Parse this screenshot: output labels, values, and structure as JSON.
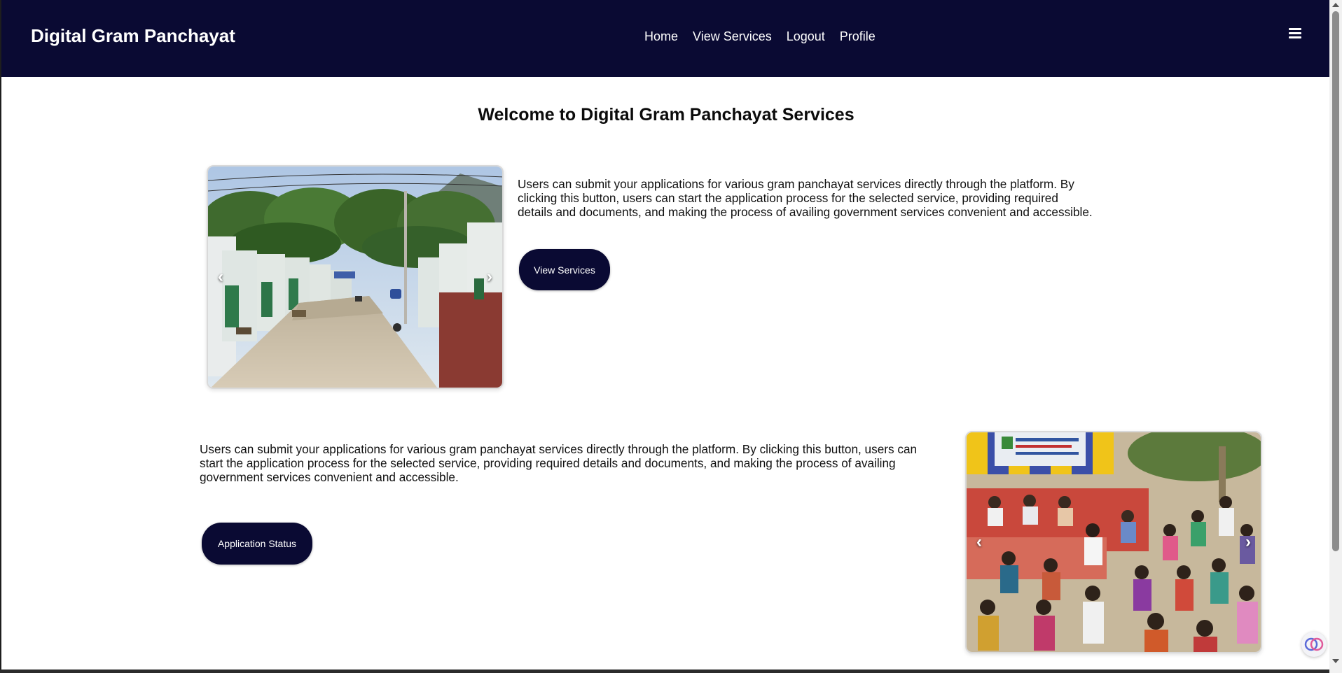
{
  "navbar": {
    "brand": "Digital Gram Panchayat",
    "links": [
      {
        "label": "Home"
      },
      {
        "label": "View Services"
      },
      {
        "label": "Logout"
      },
      {
        "label": "Profile"
      }
    ],
    "menu_icon": "hamburger-icon",
    "background": "#0a0a33"
  },
  "main": {
    "title": "Welcome to Digital Gram Panchayat Services",
    "section1": {
      "image": "village-street-photo",
      "description": "Users can submit your applications for various gram panchayat services directly through the platform. By clicking this button, users can start the application process for the selected service, providing required details and documents, and making the process of availing government services convenient and accessible.",
      "button_label": "View Services",
      "prev_icon": "‹",
      "next_icon": "›"
    },
    "section2": {
      "image": "village-meeting-photo",
      "description": "Users can submit your applications for various gram panchayat services directly through the platform. By clicking this button, users can start the application process for the selected service, providing required details and documents, and making the process of availing government services convenient and accessible.",
      "button_label": "Application Status",
      "prev_icon": "‹",
      "next_icon": "›"
    }
  },
  "colors": {
    "accent": "#0a0a33",
    "page_bg": "#ffffff",
    "text": "#111111"
  }
}
